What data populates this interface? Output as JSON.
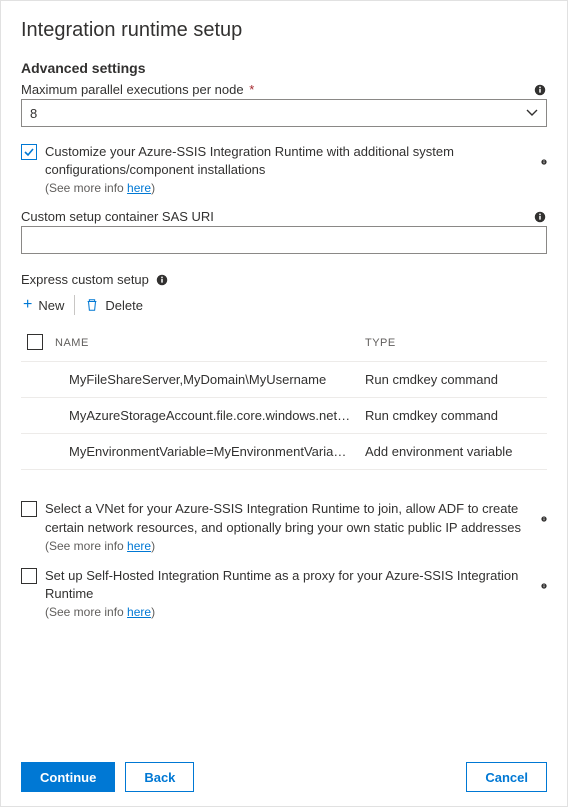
{
  "title": "Integration runtime setup",
  "advancedSettingsHeading": "Advanced settings",
  "maxParallel": {
    "label": "Maximum parallel executions per node",
    "required": "*",
    "value": "8"
  },
  "customizeCheckbox": {
    "text": "Customize your Azure-SSIS Integration Runtime with additional system configurations/component installations",
    "seeMorePrefix": "(See more info ",
    "seeMoreLink": "here",
    "seeMoreSuffix": ")"
  },
  "sasUri": {
    "label": "Custom setup container SAS URI",
    "value": ""
  },
  "expressCustomSetup": {
    "title": "Express custom setup",
    "newLabel": "New",
    "deleteLabel": "Delete",
    "headers": {
      "name": "NAME",
      "type": "TYPE"
    },
    "rows": [
      {
        "name": "MyFileShareServer,MyDomain\\MyUsername",
        "type": "Run cmdkey command"
      },
      {
        "name": "MyAzureStorageAccount.file.core.windows.net,azu...",
        "type": "Run cmdkey command"
      },
      {
        "name": "MyEnvironmentVariable=MyEnvironmentVariableValu...",
        "type": "Add environment variable"
      }
    ]
  },
  "vnetCheckbox": {
    "text": "Select a VNet for your Azure-SSIS Integration Runtime to join, allow ADF to create certain network resources, and optionally bring your own static public IP addresses",
    "seeMorePrefix": "(See more info ",
    "seeMoreLink": "here",
    "seeMoreSuffix": ")"
  },
  "proxyCheckbox": {
    "text": "Set up Self-Hosted Integration Runtime as a proxy for your Azure-SSIS Integration Runtime",
    "seeMorePrefix": "(See more info ",
    "seeMoreLink": "here",
    "seeMoreSuffix": ")"
  },
  "footer": {
    "continue": "Continue",
    "back": "Back",
    "cancel": "Cancel"
  }
}
